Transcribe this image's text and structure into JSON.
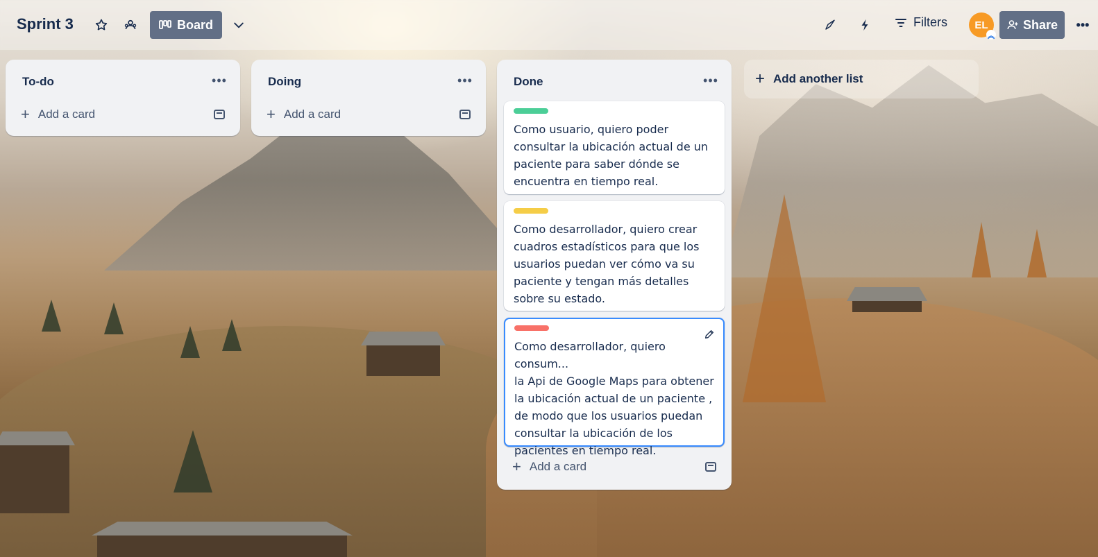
{
  "board": {
    "title": "Sprint 3",
    "view_label": "Board",
    "filters_label": "Filters",
    "share_label": "Share",
    "avatar_initials": "EL"
  },
  "icons": {
    "star": "star-icon",
    "workspace_visibility": "visibility-icon",
    "board_view": "board-view-icon",
    "views_dropdown": "chevron-down-icon",
    "power_ups": "rocket-icon",
    "automation": "lightning-icon",
    "filter": "filter-icon",
    "share": "add-person-icon",
    "more": "more-icon"
  },
  "colors": {
    "green_label": "#4bce97",
    "yellow_label": "#f5cd47",
    "red_label": "#f87168",
    "selected_border": "#388bff",
    "avatar_bg": "#f79a25",
    "button_bg": "#626f86"
  },
  "lists": [
    {
      "title": "To-do",
      "add_card_label": "Add a card",
      "cards": []
    },
    {
      "title": "Doing",
      "add_card_label": "Add a card",
      "cards": []
    },
    {
      "title": "Done",
      "add_card_label": "Add a card",
      "cards": [
        {
          "label_color": "green",
          "text": "Como usuario, quiero poder consultar la ubicación actual de un paciente para saber dónde se encuentra en tiempo real."
        },
        {
          "label_color": "yellow",
          "text": "Como desarrollador, quiero crear cuadros estadísticos para que los usuarios puedan ver cómo va su paciente y tengan más detalles sobre su estado."
        },
        {
          "label_color": "red",
          "text_first_line": "Como desarrollador, quiero consum...",
          "text_rest": "la Api de Google Maps para obtener la ubicación actual de un paciente , de modo que los usuarios puedan consultar la ubicación de los pacientes en tiempo real."
        }
      ]
    }
  ],
  "add_list_label": "Add another list"
}
